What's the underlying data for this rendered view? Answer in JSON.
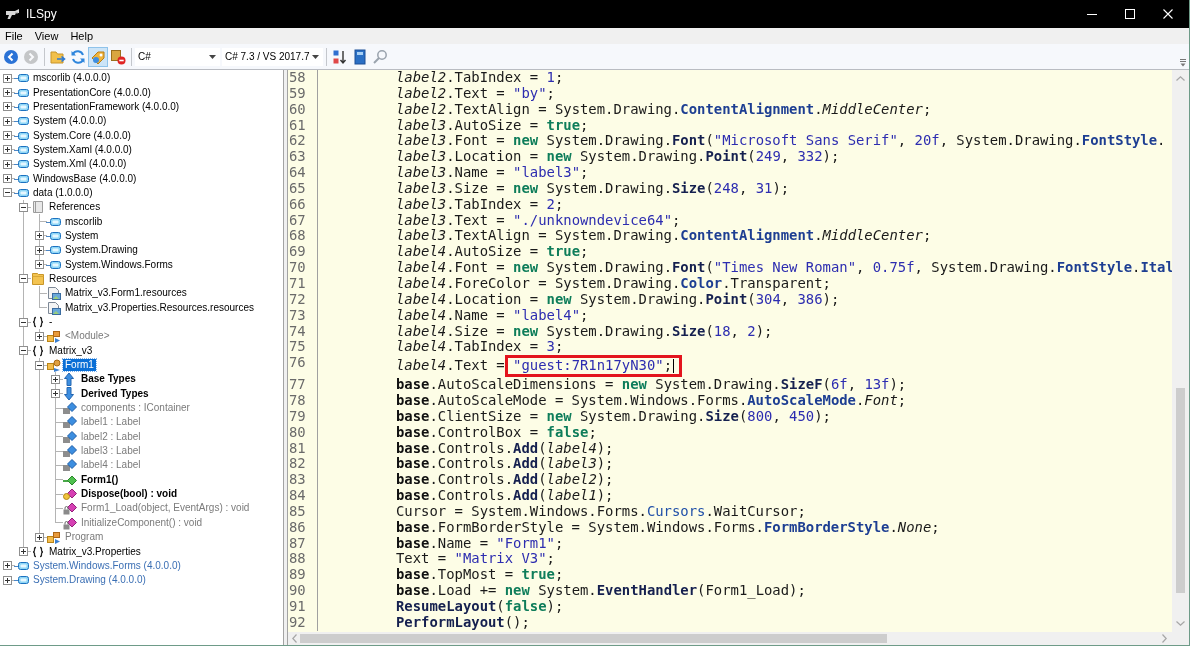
{
  "window": {
    "title": "ILSpy"
  },
  "menu": {
    "items": [
      "File",
      "View",
      "Help"
    ]
  },
  "toolbar": {
    "items": [
      {
        "kind": "back",
        "pressed": false,
        "disabled": false
      },
      {
        "kind": "forward",
        "pressed": false,
        "disabled": true
      },
      {
        "kind": "separator"
      },
      {
        "kind": "folder",
        "pressed": false,
        "disabled": false
      },
      {
        "kind": "refresh",
        "pressed": false,
        "disabled": false
      },
      {
        "kind": "filter",
        "pressed": true,
        "disabled": false
      },
      {
        "kind": "remove",
        "pressed": false,
        "disabled": false
      },
      {
        "kind": "separator"
      },
      {
        "kind": "combo",
        "value": "C#"
      },
      {
        "kind": "combo",
        "value": "C# 7.3 / VS 2017.7"
      },
      {
        "kind": "separator"
      },
      {
        "kind": "sort",
        "pressed": false,
        "disabled": false
      },
      {
        "kind": "book",
        "pressed": false,
        "disabled": false
      },
      {
        "kind": "search",
        "pressed": false,
        "disabled": false
      }
    ]
  },
  "tree": {
    "nodes": [
      {
        "label": "mscorlib (4.0.0.0)",
        "kind": "assembly",
        "dimmed": false,
        "bold": false,
        "auto_loaded": false,
        "expanded": false,
        "selected": false
      },
      {
        "label": "PresentationCore (4.0.0.0)",
        "kind": "assembly",
        "dimmed": false,
        "bold": false,
        "auto_loaded": false,
        "expanded": false,
        "selected": false
      },
      {
        "label": "PresentationFramework (4.0.0.0)",
        "kind": "assembly",
        "dimmed": false,
        "bold": false,
        "auto_loaded": false,
        "expanded": false,
        "selected": false
      },
      {
        "label": "System (4.0.0.0)",
        "kind": "assembly",
        "dimmed": false,
        "bold": false,
        "auto_loaded": false,
        "expanded": false,
        "selected": false
      },
      {
        "label": "System.Core (4.0.0.0)",
        "kind": "assembly",
        "dimmed": false,
        "bold": false,
        "auto_loaded": false,
        "expanded": false,
        "selected": false
      },
      {
        "label": "System.Xaml (4.0.0.0)",
        "kind": "assembly",
        "dimmed": false,
        "bold": false,
        "auto_loaded": false,
        "expanded": false,
        "selected": false
      },
      {
        "label": "System.Xml (4.0.0.0)",
        "kind": "assembly",
        "dimmed": false,
        "bold": false,
        "auto_loaded": false,
        "expanded": false,
        "selected": false
      },
      {
        "label": "WindowsBase (4.0.0.0)",
        "kind": "assembly",
        "dimmed": false,
        "bold": false,
        "auto_loaded": false,
        "expanded": false,
        "selected": false
      },
      {
        "label": "data (1.0.0.0)",
        "kind": "assembly",
        "dimmed": false,
        "bold": false,
        "auto_loaded": false,
        "expanded": true,
        "selected": false,
        "children": [
          {
            "label": "References",
            "kind": "references",
            "dimmed": false,
            "bold": false,
            "expanded": true,
            "selected": false,
            "children": [
              {
                "label": "mscorlib",
                "kind": "assembly",
                "dimmed": false,
                "bold": false,
                "selected": false
              },
              {
                "label": "System",
                "kind": "assembly",
                "dimmed": false,
                "bold": false,
                "expanded": false,
                "selected": false
              },
              {
                "label": "System.Drawing",
                "kind": "assembly",
                "dimmed": false,
                "bold": false,
                "expanded": false,
                "selected": false
              },
              {
                "label": "System.Windows.Forms",
                "kind": "assembly",
                "dimmed": false,
                "bold": false,
                "expanded": false,
                "selected": false
              }
            ]
          },
          {
            "label": "Resources",
            "kind": "folder",
            "dimmed": false,
            "bold": false,
            "expanded": true,
            "selected": false,
            "children": [
              {
                "label": "Matrix_v3.Form1.resources",
                "kind": "resource",
                "dimmed": false,
                "bold": false,
                "selected": false
              },
              {
                "label": "Matrix_v3.Properties.Resources.resources",
                "kind": "resource",
                "dimmed": false,
                "bold": false,
                "selected": false
              }
            ]
          },
          {
            "label": "-",
            "kind": "namespace",
            "dimmed": false,
            "bold": false,
            "expanded": true,
            "selected": false,
            "children": [
              {
                "label": "<Module>",
                "kind": "class",
                "dimmed": true,
                "bold": false,
                "expanded": false,
                "selected": false
              }
            ]
          },
          {
            "label": "Matrix_v3",
            "kind": "namespace",
            "dimmed": false,
            "bold": false,
            "expanded": true,
            "selected": false,
            "children": [
              {
                "label": "Form1",
                "kind": "form",
                "dimmed": false,
                "bold": false,
                "expanded": true,
                "selected": true,
                "children": [
                  {
                    "label": "Base Types",
                    "kind": "base-types",
                    "dimmed": false,
                    "bold": true,
                    "expanded": false,
                    "selected": false
                  },
                  {
                    "label": "Derived Types",
                    "kind": "derived-types",
                    "dimmed": false,
                    "bold": true,
                    "expanded": false,
                    "selected": false
                  },
                  {
                    "label": "components : IContainer",
                    "kind": "field",
                    "dimmed": true,
                    "bold": false,
                    "selected": false
                  },
                  {
                    "label": "label1 : Label",
                    "kind": "field",
                    "dimmed": true,
                    "bold": false,
                    "selected": false
                  },
                  {
                    "label": "label2 : Label",
                    "kind": "field",
                    "dimmed": true,
                    "bold": false,
                    "selected": false
                  },
                  {
                    "label": "label3 : Label",
                    "kind": "field",
                    "dimmed": true,
                    "bold": false,
                    "selected": false
                  },
                  {
                    "label": "label4 : Label",
                    "kind": "field",
                    "dimmed": true,
                    "bold": false,
                    "selected": false
                  },
                  {
                    "label": "Form1()",
                    "kind": "ctor",
                    "dimmed": false,
                    "bold": true,
                    "selected": false
                  },
                  {
                    "label": "Dispose(bool) : void",
                    "kind": "method-protected",
                    "dimmed": false,
                    "bold": true,
                    "selected": false
                  },
                  {
                    "label": "Form1_Load(object, EventArgs) : void",
                    "kind": "method-private",
                    "dimmed": true,
                    "bold": false,
                    "selected": false
                  },
                  {
                    "label": "InitializeComponent() : void",
                    "kind": "method-private",
                    "dimmed": true,
                    "bold": false,
                    "selected": false
                  }
                ]
              },
              {
                "label": "Program",
                "kind": "class",
                "dimmed": true,
                "bold": false,
                "expanded": false,
                "selected": false
              }
            ]
          },
          {
            "label": "Matrix_v3.Properties",
            "kind": "namespace",
            "dimmed": false,
            "bold": false,
            "expanded": false,
            "selected": false
          }
        ]
      },
      {
        "label": "System.Windows.Forms (4.0.0.0)",
        "kind": "assembly",
        "dimmed": false,
        "bold": false,
        "auto_loaded": true,
        "expanded": false,
        "selected": false
      },
      {
        "label": "System.Drawing (4.0.0.0)",
        "kind": "assembly",
        "dimmed": false,
        "bold": false,
        "auto_loaded": true,
        "expanded": false,
        "selected": false
      }
    ]
  },
  "editor": {
    "lines": [
      {
        "number": "58",
        "tokens": [
          {
            "kind": "var",
            "text": "label2"
          },
          {
            "kind": "plain",
            "text": ".TabIndex = "
          },
          {
            "kind": "num",
            "text": "1"
          },
          {
            "kind": "plain",
            "text": ";"
          }
        ]
      },
      {
        "number": "59",
        "tokens": [
          {
            "kind": "var",
            "text": "label2"
          },
          {
            "kind": "plain",
            "text": ".Text = "
          },
          {
            "kind": "str",
            "text": "\"by\""
          },
          {
            "kind": "plain",
            "text": ";"
          }
        ]
      },
      {
        "number": "60",
        "tokens": [
          {
            "kind": "var",
            "text": "label2"
          },
          {
            "kind": "plain",
            "text": ".TextAlign = System.Drawing."
          },
          {
            "kind": "type",
            "text": "ContentAlignment"
          },
          {
            "kind": "plain",
            "text": "."
          },
          {
            "kind": "enum",
            "text": "MiddleCenter"
          },
          {
            "kind": "plain",
            "text": ";"
          }
        ]
      },
      {
        "number": "61",
        "tokens": [
          {
            "kind": "var",
            "text": "label3"
          },
          {
            "kind": "plain",
            "text": ".AutoSize = "
          },
          {
            "kind": "kw",
            "text": "true"
          },
          {
            "kind": "plain",
            "text": ";"
          }
        ]
      },
      {
        "number": "62",
        "tokens": [
          {
            "kind": "var",
            "text": "label3"
          },
          {
            "kind": "plain",
            "text": ".Font = "
          },
          {
            "kind": "kw",
            "text": "new"
          },
          {
            "kind": "plain",
            "text": " System.Drawing."
          },
          {
            "kind": "call",
            "text": "Font"
          },
          {
            "kind": "plain",
            "text": "("
          },
          {
            "kind": "str",
            "text": "\"Microsoft Sans Serif\""
          },
          {
            "kind": "plain",
            "text": ", "
          },
          {
            "kind": "num",
            "text": "20f"
          },
          {
            "kind": "plain",
            "text": ", System.Drawing."
          },
          {
            "kind": "type",
            "text": "FontStyle"
          },
          {
            "kind": "plain",
            "text": "."
          }
        ]
      },
      {
        "number": "63",
        "tokens": [
          {
            "kind": "var",
            "text": "label3"
          },
          {
            "kind": "plain",
            "text": ".Location = "
          },
          {
            "kind": "kw",
            "text": "new"
          },
          {
            "kind": "plain",
            "text": " System.Drawing."
          },
          {
            "kind": "call",
            "text": "Point"
          },
          {
            "kind": "plain",
            "text": "("
          },
          {
            "kind": "num",
            "text": "249"
          },
          {
            "kind": "plain",
            "text": ", "
          },
          {
            "kind": "num",
            "text": "332"
          },
          {
            "kind": "plain",
            "text": ");"
          }
        ]
      },
      {
        "number": "64",
        "tokens": [
          {
            "kind": "var",
            "text": "label3"
          },
          {
            "kind": "plain",
            "text": ".Name = "
          },
          {
            "kind": "str",
            "text": "\"label3\""
          },
          {
            "kind": "plain",
            "text": ";"
          }
        ]
      },
      {
        "number": "65",
        "tokens": [
          {
            "kind": "var",
            "text": "label3"
          },
          {
            "kind": "plain",
            "text": ".Size = "
          },
          {
            "kind": "kw",
            "text": "new"
          },
          {
            "kind": "plain",
            "text": " System.Drawing."
          },
          {
            "kind": "call",
            "text": "Size"
          },
          {
            "kind": "plain",
            "text": "("
          },
          {
            "kind": "num",
            "text": "248"
          },
          {
            "kind": "plain",
            "text": ", "
          },
          {
            "kind": "num",
            "text": "31"
          },
          {
            "kind": "plain",
            "text": ");"
          }
        ]
      },
      {
        "number": "66",
        "tokens": [
          {
            "kind": "var",
            "text": "label3"
          },
          {
            "kind": "plain",
            "text": ".TabIndex = "
          },
          {
            "kind": "num",
            "text": "2"
          },
          {
            "kind": "plain",
            "text": ";"
          }
        ]
      },
      {
        "number": "67",
        "tokens": [
          {
            "kind": "var",
            "text": "label3"
          },
          {
            "kind": "plain",
            "text": ".Text = "
          },
          {
            "kind": "str",
            "text": "\"./unknowndevice64\""
          },
          {
            "kind": "plain",
            "text": ";"
          }
        ]
      },
      {
        "number": "68",
        "tokens": [
          {
            "kind": "var",
            "text": "label3"
          },
          {
            "kind": "plain",
            "text": ".TextAlign = System.Drawing."
          },
          {
            "kind": "type",
            "text": "ContentAlignment"
          },
          {
            "kind": "plain",
            "text": "."
          },
          {
            "kind": "enum",
            "text": "MiddleCenter"
          },
          {
            "kind": "plain",
            "text": ";"
          }
        ]
      },
      {
        "number": "69",
        "tokens": [
          {
            "kind": "var",
            "text": "label4"
          },
          {
            "kind": "plain",
            "text": ".AutoSize = "
          },
          {
            "kind": "kw",
            "text": "true"
          },
          {
            "kind": "plain",
            "text": ";"
          }
        ]
      },
      {
        "number": "70",
        "tokens": [
          {
            "kind": "var",
            "text": "label4"
          },
          {
            "kind": "plain",
            "text": ".Font = "
          },
          {
            "kind": "kw",
            "text": "new"
          },
          {
            "kind": "plain",
            "text": " System.Drawing."
          },
          {
            "kind": "call",
            "text": "Font"
          },
          {
            "kind": "plain",
            "text": "("
          },
          {
            "kind": "str",
            "text": "\"Times New Roman\""
          },
          {
            "kind": "plain",
            "text": ", "
          },
          {
            "kind": "num",
            "text": "0.75f"
          },
          {
            "kind": "plain",
            "text": ", System.Drawing."
          },
          {
            "kind": "type",
            "text": "FontStyle"
          },
          {
            "kind": "plain",
            "text": "."
          },
          {
            "kind": "type",
            "text": "Ital"
          }
        ]
      },
      {
        "number": "71",
        "tokens": [
          {
            "kind": "var",
            "text": "label4"
          },
          {
            "kind": "plain",
            "text": ".ForeColor = System.Drawing."
          },
          {
            "kind": "type",
            "text": "Color"
          },
          {
            "kind": "plain",
            "text": ".Transparent;"
          }
        ]
      },
      {
        "number": "72",
        "tokens": [
          {
            "kind": "var",
            "text": "label4"
          },
          {
            "kind": "plain",
            "text": ".Location = "
          },
          {
            "kind": "kw",
            "text": "new"
          },
          {
            "kind": "plain",
            "text": " System.Drawing."
          },
          {
            "kind": "call",
            "text": "Point"
          },
          {
            "kind": "plain",
            "text": "("
          },
          {
            "kind": "num",
            "text": "304"
          },
          {
            "kind": "plain",
            "text": ", "
          },
          {
            "kind": "num",
            "text": "386"
          },
          {
            "kind": "plain",
            "text": ");"
          }
        ]
      },
      {
        "number": "73",
        "tokens": [
          {
            "kind": "var",
            "text": "label4"
          },
          {
            "kind": "plain",
            "text": ".Name = "
          },
          {
            "kind": "str",
            "text": "\"label4\""
          },
          {
            "kind": "plain",
            "text": ";"
          }
        ]
      },
      {
        "number": "74",
        "tokens": [
          {
            "kind": "var",
            "text": "label4"
          },
          {
            "kind": "plain",
            "text": ".Size = "
          },
          {
            "kind": "kw",
            "text": "new"
          },
          {
            "kind": "plain",
            "text": " System.Drawing."
          },
          {
            "kind": "call",
            "text": "Size"
          },
          {
            "kind": "plain",
            "text": "("
          },
          {
            "kind": "num",
            "text": "18"
          },
          {
            "kind": "plain",
            "text": ", "
          },
          {
            "kind": "num",
            "text": "2"
          },
          {
            "kind": "plain",
            "text": ");"
          }
        ]
      },
      {
        "number": "75",
        "tokens": [
          {
            "kind": "var",
            "text": "label4"
          },
          {
            "kind": "plain",
            "text": ".TabIndex = "
          },
          {
            "kind": "num",
            "text": "3"
          },
          {
            "kind": "plain",
            "text": ";"
          }
        ]
      },
      {
        "number": "76",
        "tokens": [
          {
            "kind": "var",
            "text": "label4"
          },
          {
            "kind": "plain",
            "text": ".Text ="
          },
          {
            "kind": "mark",
            "tokens": [
              {
                "kind": "str",
                "text": "\"guest:7R1n17yN30\""
              },
              {
                "kind": "plain",
                "text": ";"
              },
              {
                "kind": "caret"
              }
            ]
          }
        ]
      },
      {
        "number": "77",
        "tokens": [
          {
            "kind": "base",
            "text": "base"
          },
          {
            "kind": "plain",
            "text": ".AutoScaleDimensions = "
          },
          {
            "kind": "kw",
            "text": "new"
          },
          {
            "kind": "plain",
            "text": " System.Drawing."
          },
          {
            "kind": "call",
            "text": "SizeF"
          },
          {
            "kind": "plain",
            "text": "("
          },
          {
            "kind": "num",
            "text": "6f"
          },
          {
            "kind": "plain",
            "text": ", "
          },
          {
            "kind": "num",
            "text": "13f"
          },
          {
            "kind": "plain",
            "text": ");"
          }
        ]
      },
      {
        "number": "78",
        "tokens": [
          {
            "kind": "base",
            "text": "base"
          },
          {
            "kind": "plain",
            "text": ".AutoScaleMode = System.Windows.Forms."
          },
          {
            "kind": "type",
            "text": "AutoScaleMode"
          },
          {
            "kind": "plain",
            "text": "."
          },
          {
            "kind": "enum",
            "text": "Font"
          },
          {
            "kind": "plain",
            "text": ";"
          }
        ]
      },
      {
        "number": "79",
        "tokens": [
          {
            "kind": "base",
            "text": "base"
          },
          {
            "kind": "plain",
            "text": ".ClientSize = "
          },
          {
            "kind": "kw",
            "text": "new"
          },
          {
            "kind": "plain",
            "text": " System.Drawing."
          },
          {
            "kind": "call",
            "text": "Size"
          },
          {
            "kind": "plain",
            "text": "("
          },
          {
            "kind": "num",
            "text": "800"
          },
          {
            "kind": "plain",
            "text": ", "
          },
          {
            "kind": "num",
            "text": "450"
          },
          {
            "kind": "plain",
            "text": ");"
          }
        ]
      },
      {
        "number": "80",
        "tokens": [
          {
            "kind": "base",
            "text": "base"
          },
          {
            "kind": "plain",
            "text": ".ControlBox = "
          },
          {
            "kind": "kw",
            "text": "false"
          },
          {
            "kind": "plain",
            "text": ";"
          }
        ]
      },
      {
        "number": "81",
        "tokens": [
          {
            "kind": "base",
            "text": "base"
          },
          {
            "kind": "plain",
            "text": ".Controls."
          },
          {
            "kind": "call",
            "text": "Add"
          },
          {
            "kind": "plain",
            "text": "("
          },
          {
            "kind": "var",
            "text": "label4"
          },
          {
            "kind": "plain",
            "text": ");"
          }
        ]
      },
      {
        "number": "82",
        "tokens": [
          {
            "kind": "base",
            "text": "base"
          },
          {
            "kind": "plain",
            "text": ".Controls."
          },
          {
            "kind": "call",
            "text": "Add"
          },
          {
            "kind": "plain",
            "text": "("
          },
          {
            "kind": "var",
            "text": "label3"
          },
          {
            "kind": "plain",
            "text": ");"
          }
        ]
      },
      {
        "number": "83",
        "tokens": [
          {
            "kind": "base",
            "text": "base"
          },
          {
            "kind": "plain",
            "text": ".Controls."
          },
          {
            "kind": "call",
            "text": "Add"
          },
          {
            "kind": "plain",
            "text": "("
          },
          {
            "kind": "var",
            "text": "label2"
          },
          {
            "kind": "plain",
            "text": ");"
          }
        ]
      },
      {
        "number": "84",
        "tokens": [
          {
            "kind": "base",
            "text": "base"
          },
          {
            "kind": "plain",
            "text": ".Controls."
          },
          {
            "kind": "call",
            "text": "Add"
          },
          {
            "kind": "plain",
            "text": "("
          },
          {
            "kind": "var",
            "text": "label1"
          },
          {
            "kind": "plain",
            "text": ");"
          }
        ]
      },
      {
        "number": "85",
        "tokens": [
          {
            "kind": "plain",
            "text": "Cursor = System.Windows.Forms."
          },
          {
            "kind": "typeref",
            "text": "Cursors"
          },
          {
            "kind": "plain",
            "text": ".WaitCursor;"
          }
        ]
      },
      {
        "number": "86",
        "tokens": [
          {
            "kind": "base",
            "text": "base"
          },
          {
            "kind": "plain",
            "text": ".FormBorderStyle = System.Windows.Forms."
          },
          {
            "kind": "type",
            "text": "FormBorderStyle"
          },
          {
            "kind": "plain",
            "text": "."
          },
          {
            "kind": "enum",
            "text": "None"
          },
          {
            "kind": "plain",
            "text": ";"
          }
        ]
      },
      {
        "number": "87",
        "tokens": [
          {
            "kind": "base",
            "text": "base"
          },
          {
            "kind": "plain",
            "text": ".Name = "
          },
          {
            "kind": "str",
            "text": "\"Form1\""
          },
          {
            "kind": "plain",
            "text": ";"
          }
        ]
      },
      {
        "number": "88",
        "tokens": [
          {
            "kind": "plain",
            "text": "Text = "
          },
          {
            "kind": "str",
            "text": "\"Matrix V3\""
          },
          {
            "kind": "plain",
            "text": ";"
          }
        ]
      },
      {
        "number": "89",
        "tokens": [
          {
            "kind": "base",
            "text": "base"
          },
          {
            "kind": "plain",
            "text": ".TopMost = "
          },
          {
            "kind": "kw",
            "text": "true"
          },
          {
            "kind": "plain",
            "text": ";"
          }
        ]
      },
      {
        "number": "90",
        "tokens": [
          {
            "kind": "base",
            "text": "base"
          },
          {
            "kind": "plain",
            "text": ".Load += "
          },
          {
            "kind": "kw",
            "text": "new"
          },
          {
            "kind": "plain",
            "text": " System."
          },
          {
            "kind": "call",
            "text": "EventHandler"
          },
          {
            "kind": "plain",
            "text": "(Form1_Load);"
          }
        ]
      },
      {
        "number": "91",
        "tokens": [
          {
            "kind": "call",
            "text": "ResumeLayout"
          },
          {
            "kind": "plain",
            "text": "("
          },
          {
            "kind": "kw",
            "text": "false"
          },
          {
            "kind": "plain",
            "text": ");"
          }
        ]
      },
      {
        "number": "92",
        "tokens": [
          {
            "kind": "call",
            "text": "PerformLayout"
          },
          {
            "kind": "plain",
            "text": "();"
          }
        ]
      }
    ]
  }
}
